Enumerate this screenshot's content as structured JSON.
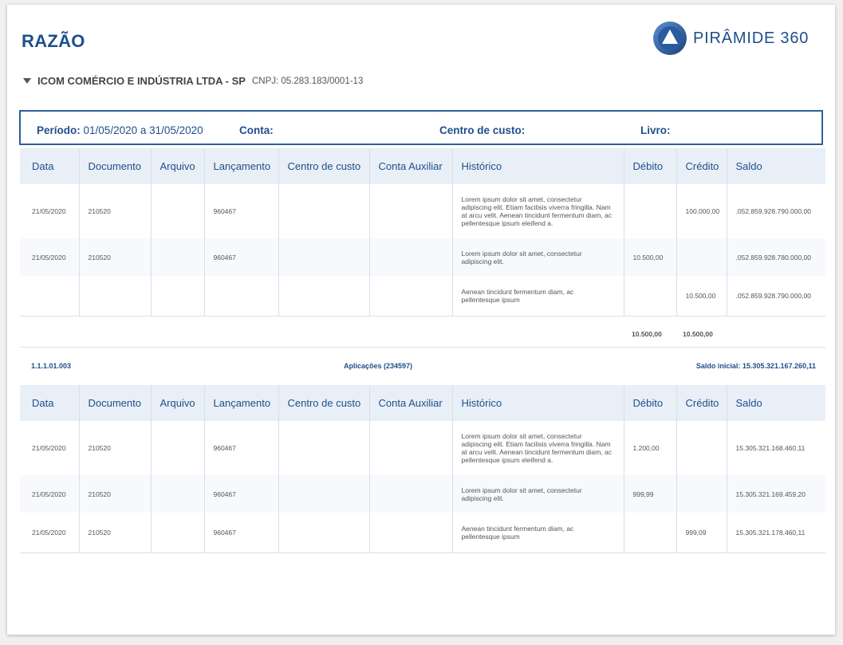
{
  "title": "RAZÃO",
  "logo": {
    "text": "PIRÂMIDE 360",
    "icon": "pyramid-logo-icon"
  },
  "company": {
    "name": "ICOM COMÉRCIO E INDÚSTRIA LTDA - SP",
    "cnpj": "CNPJ: 05.283.183/0001-13"
  },
  "filters": {
    "periodo_label": "Período:",
    "periodo_value": "01/05/2020 a 31/05/2020",
    "conta_label": "Conta:",
    "centro_label": "Centro de custo:",
    "livro_label": "Livro:"
  },
  "columns": [
    "Data",
    "Documento",
    "Arquivo",
    "Lançamento",
    "Centro de custo",
    "Conta Auxiliar",
    "Histórico",
    "Débito",
    "Crédito",
    "Saldo"
  ],
  "table1": {
    "rows": [
      {
        "data": "21/05/2020",
        "documento": "210520",
        "arquivo": "",
        "lancamento": "960467",
        "centro": "",
        "auxiliar": "",
        "historico": "Lorem ipsum dolor sit amet, consectetur adipiscing elit. Etiam facilisis viverra fringilla. Nam at arcu velit. Aenean tincidunt fermentum diam, ac pellentesque ipsum eleifend a.",
        "debito": "",
        "credito": "100.000,00",
        "saldo": ".052.859.928.790.000,00"
      },
      {
        "data": "21/05/2020",
        "documento": "210520",
        "arquivo": "",
        "lancamento": "960467",
        "centro": "",
        "auxiliar": "",
        "historico": "Lorem ipsum dolor sit amet, consectetur adipiscing elit.",
        "debito": "10.500,00",
        "credito": "",
        "saldo": ".052.859.928.780.000,00"
      },
      {
        "data": "",
        "documento": "",
        "arquivo": "",
        "lancamento": "",
        "centro": "",
        "auxiliar": "",
        "historico": "Aenean tincidunt fermentum diam, ac pellentesque ipsum",
        "debito": "",
        "credito": "10.500,00",
        "saldo": ".052.859.928.790.000,00"
      }
    ],
    "total_debito": "10.500,00",
    "total_credito": "10.500,00"
  },
  "account": {
    "code": "1.1.1.01.003",
    "name": "Aplicações (234597)",
    "saldo_inicial": "Saldo inicial: 15.305.321.167.260,11"
  },
  "table2": {
    "rows": [
      {
        "data": "21/05/2020",
        "documento": "210520",
        "arquivo": "",
        "lancamento": "960467",
        "centro": "",
        "auxiliar": "",
        "historico": "Lorem ipsum dolor sit amet, consectetur adipiscing elit. Etiam facilisis viverra fringilla. Nam at arcu velit. Aenean tincidunt fermentum diam, ac pellentesque ipsum eleifend a.",
        "debito": "1.200,00",
        "credito": "",
        "saldo": "15.305.321.168.460,11"
      },
      {
        "data": "21/05/2020",
        "documento": "210520",
        "arquivo": "",
        "lancamento": "960467",
        "centro": "",
        "auxiliar": "",
        "historico": "Lorem ipsum dolor sit amet, consectetur adipiscing elit.",
        "debito": "999,99",
        "credito": "",
        "saldo": "15.305.321.169.459,20"
      },
      {
        "data": "21/05/2020",
        "documento": "210520",
        "arquivo": "",
        "lancamento": "960467",
        "centro": "",
        "auxiliar": "",
        "historico": "Aenean tincidunt fermentum diam, ac pellentesque ipsum",
        "debito": "",
        "credito": "999,09",
        "saldo": "15.305.321.178.460,11"
      }
    ]
  }
}
